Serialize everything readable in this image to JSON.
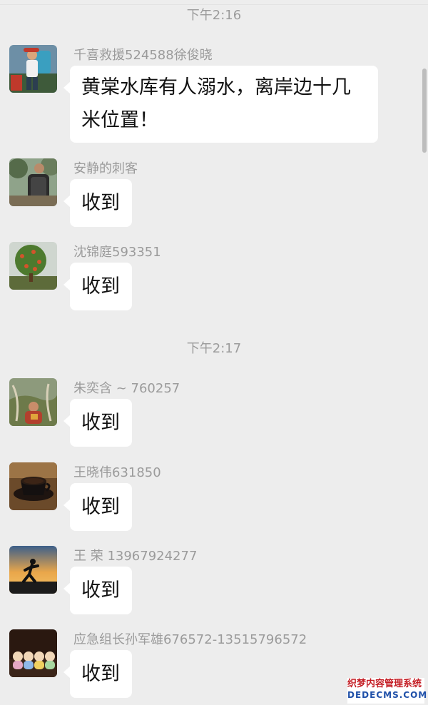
{
  "timestamps": [
    "下午2:16",
    "下午2:17"
  ],
  "messages": [
    {
      "sender": "千喜救援524588徐俊晓",
      "text": "黄棠水库有人溺水，离岸边十几米位置！",
      "line1": "黄棠水库有人溺水，离岸边十几",
      "line2": "米位置！",
      "avatar": "hiker-backpack"
    },
    {
      "sender": "安静的刺客",
      "text": "收到",
      "avatar": "person-backpack-trees"
    },
    {
      "sender": "沈锦庭593351",
      "text": "收到",
      "avatar": "fruit-tree"
    },
    {
      "sender": "朱奕含 ~ 760257",
      "text": "收到",
      "avatar": "person-field"
    },
    {
      "sender": "王晓伟631850",
      "text": "收到",
      "avatar": "coffee-cup"
    },
    {
      "sender": "王 荣 13967924277",
      "text": "收到",
      "avatar": "runner-sunset"
    },
    {
      "sender": "应急组长孙军雄676572-13515796572",
      "text": "收到",
      "avatar": "monk-figurines"
    }
  ],
  "watermark": {
    "cn": "织梦内容管理系统",
    "en": "DEDECMS.COM"
  },
  "colors": {
    "background": "#ededed",
    "bubble": "#ffffff",
    "meta_text": "#9b9b9b"
  }
}
